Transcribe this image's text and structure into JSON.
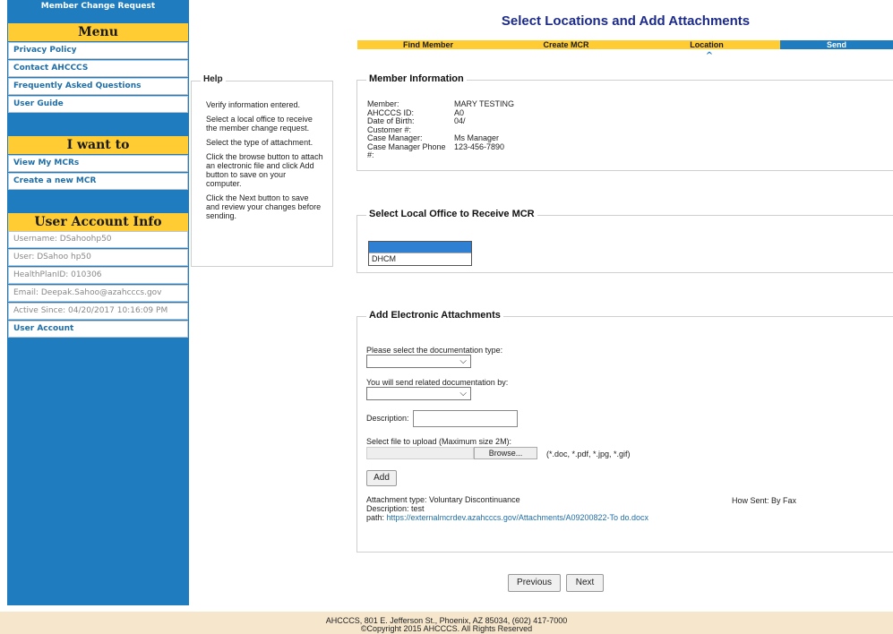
{
  "sidebar": {
    "app_title": "Member Change Request",
    "menu": {
      "header": "Menu",
      "items": [
        {
          "label": "Privacy Policy"
        },
        {
          "label": "Contact AHCCCS"
        },
        {
          "label": "Frequently Asked Questions"
        },
        {
          "label": "User Guide"
        }
      ]
    },
    "i_want_to": {
      "header": "I want to",
      "items": [
        {
          "label": "View My MCRs"
        },
        {
          "label": "Create a new MCR"
        }
      ]
    },
    "user_account": {
      "header": "User Account Info",
      "username": "Username: DSahoohp50",
      "user": "User: DSahoo hp50",
      "healthplan": "HealthPlanID: 010306",
      "email": "Email: Deepak.Sahoo@azahcccs.gov",
      "active_since": "Active Since: 04/20/2017 10:16:09 PM",
      "account_link": "User Account"
    }
  },
  "help": {
    "title": "Help",
    "paragraphs": [
      "Verify information entered.",
      "Select a local office to receive the member change request.",
      "Select the type of attachment.",
      "Click the browse button to attach an electronic file  and click Add button to save on your computer.",
      "Click the Next button to save and review your changes before sending."
    ]
  },
  "header": {
    "title": "Select Locations and Add Attachments",
    "steps": [
      {
        "label": "Find Member"
      },
      {
        "label": "Create MCR"
      },
      {
        "label": "Location"
      },
      {
        "label": "Send"
      }
    ],
    "caret": "^"
  },
  "member_info": {
    "legend": "Member Information",
    "rows": [
      {
        "label": "Member:",
        "value": "MARY TESTING"
      },
      {
        "label": "AHCCCS ID:",
        "value": "A0"
      },
      {
        "label": "Date of Birth:",
        "value": "04/"
      },
      {
        "label": "Customer #:",
        "value": ""
      },
      {
        "label": "Case Manager:",
        "value": "Ms Manager"
      },
      {
        "label": "Case Manager Phone #:",
        "value": "123-456-7890"
      }
    ]
  },
  "local_office": {
    "legend": "Select Local Office to Receive MCR",
    "options": [
      "",
      "DHCM"
    ]
  },
  "attachments": {
    "legend": "Add Electronic Attachments",
    "doc_type_label": "Please select the documentation type:",
    "send_by_label": "You will send related documentation by:",
    "description_label": "Description:",
    "file_label": "Select file to upload (Maximum size 2M):",
    "browse_label": "Browse...",
    "file_types": "(*.doc, *.pdf, *.jpg, *.gif)",
    "add_label": "Add",
    "attachment_type": "Attachment type: Voluntary Discontinuance",
    "description": "Description: test",
    "path_label": "path: ",
    "path": "https://externalmcrdev.azahcccs.gov/Attachments/A09200822-To do.docx",
    "how_sent": "How Sent: By Fax"
  },
  "nav": {
    "previous_label": "Previous",
    "next_label": "Next"
  },
  "footer": {
    "address": "AHCCCS, 801 E. Jefferson St., Phoenix, AZ 85034, (602) 417-7000",
    "copyright": "©Copyright 2015 AHCCCS. All Rights Reserved"
  },
  "colors": {
    "sidebar_blue": "#1f7dbf",
    "accent_yellow": "#ffcc33",
    "title_navy": "#1c2b8a",
    "link_blue": "#1f6ea8",
    "footer_bg": "#f5e6cc"
  }
}
